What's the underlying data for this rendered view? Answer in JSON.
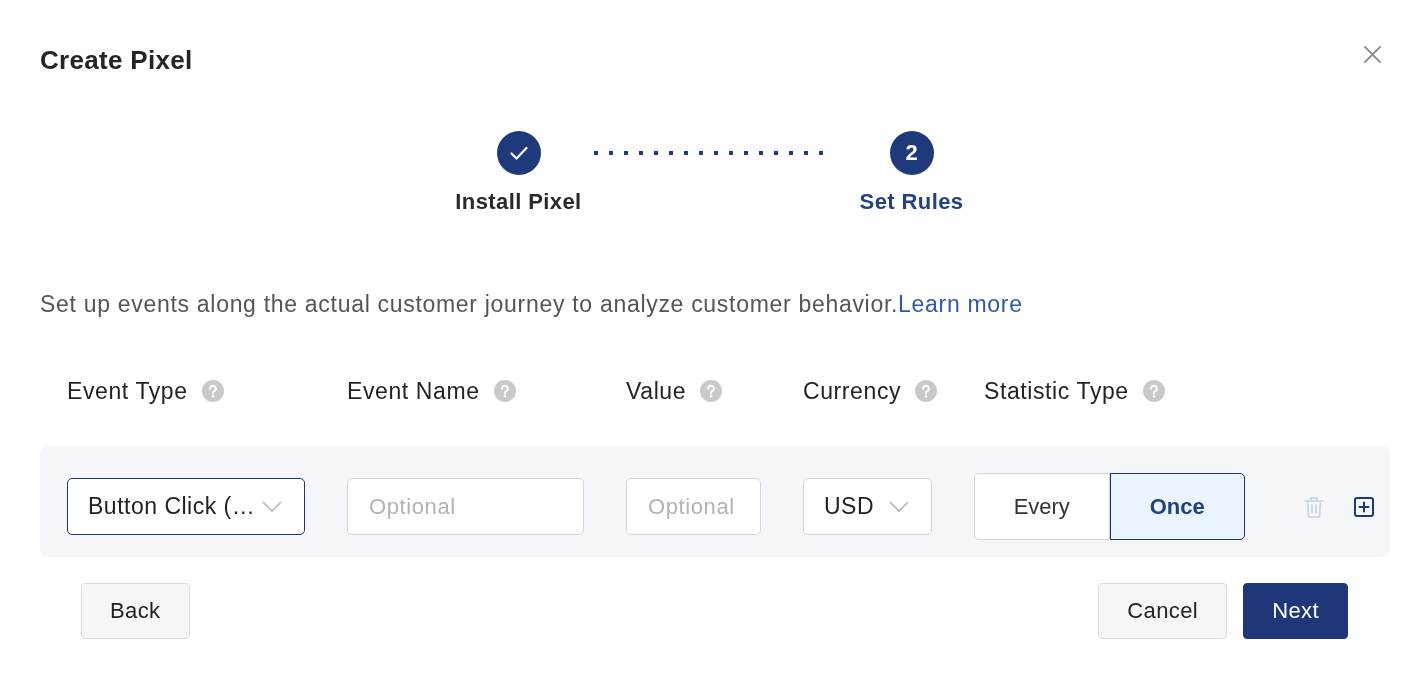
{
  "dialog": {
    "title": "Create Pixel"
  },
  "steps": [
    {
      "label": "Install Pixel",
      "completed": true,
      "selected": false
    },
    {
      "label": "Set Rules",
      "number": "2",
      "completed": false,
      "selected": true
    }
  ],
  "intro": {
    "text": "Set up events along the actual customer journey to analyze customer behavior.",
    "link": "Learn more"
  },
  "columns": [
    "Event Type",
    "Event Name",
    "Value",
    "Currency",
    "Statistic Type"
  ],
  "rules": [
    {
      "event_type": {
        "value": "Button Click (…",
        "focused": true
      },
      "event_name": {
        "placeholder": "Optional"
      },
      "value": {
        "placeholder": "Optional"
      },
      "currency": "USD",
      "statistic_options": [
        {
          "label": "Every",
          "selected": false
        },
        {
          "label": "Once",
          "selected": true
        }
      ],
      "delete_disabled": true
    }
  ],
  "footer": {
    "back": "Back",
    "cancel": "Cancel",
    "next": "Next"
  }
}
